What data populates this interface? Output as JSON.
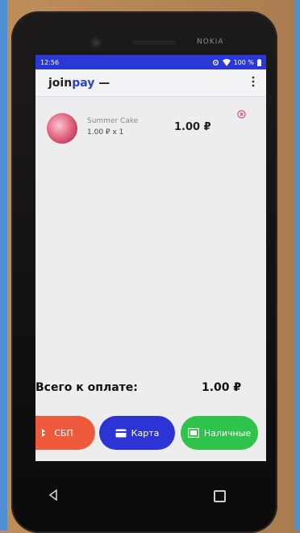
{
  "device": {
    "brand": "NOKIA"
  },
  "status_bar": {
    "time": "12:56",
    "battery": "100 %"
  },
  "app_bar": {
    "logo_prefix": "join",
    "logo_accent": "pay",
    "logo_suffix": "—",
    "menu_icon": "more-vert-icon"
  },
  "cart": {
    "items": [
      {
        "name": "Summer Cake",
        "price_qty": "1.00 ₽   x 1",
        "total": "1.00 ₽"
      }
    ]
  },
  "summary": {
    "label": "Всего к оплате:",
    "value": "1.00 ₽"
  },
  "payment_buttons": [
    {
      "label": "СБП",
      "icon": "sbp-icon",
      "color": "#f05a3c"
    },
    {
      "label": "Карта",
      "icon": "card-icon",
      "color": "#2c35d4"
    },
    {
      "label": "Наличные",
      "icon": "cash-icon",
      "color": "#2ec34a"
    }
  ],
  "colors": {
    "status_bar": "#2a38d8",
    "logo_accent": "#2a3fd8",
    "remove": "#e0405a"
  }
}
